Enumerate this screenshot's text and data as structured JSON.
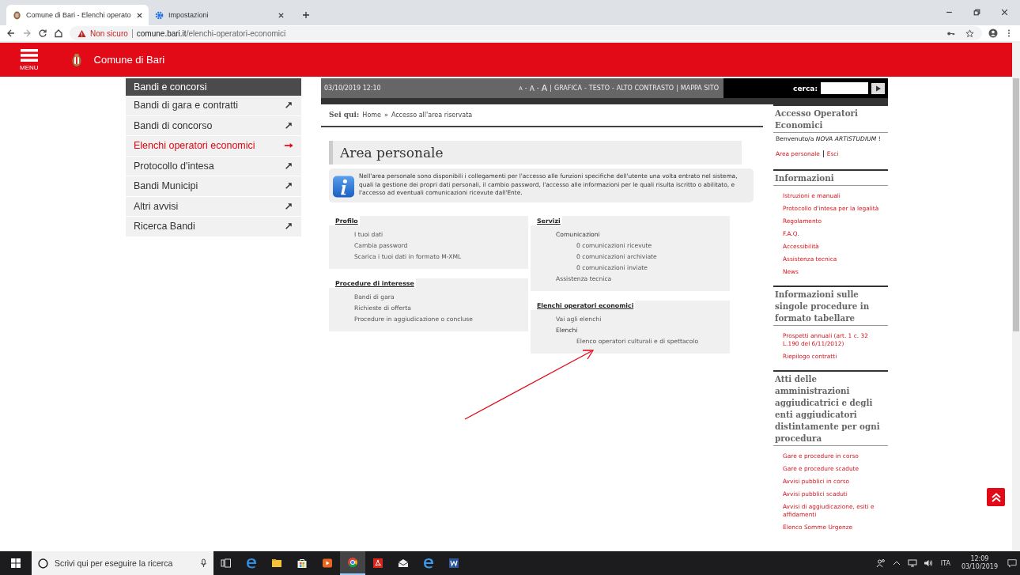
{
  "browser": {
    "tabs": [
      {
        "title": "Comune di Bari - Elenchi operato",
        "selected": true,
        "kind": "crest"
      },
      {
        "title": "Impostazioni",
        "selected": false,
        "kind": "gear"
      }
    ],
    "security": "Non sicuro",
    "url_host": "comune.bari.it",
    "url_path": "/elenchi-operatori-economici"
  },
  "header": {
    "menu_label": "MENU",
    "site_name": "Comune di Bari"
  },
  "left_menu": {
    "title": "Bandi e concorsi",
    "items": [
      {
        "label": "Bandi di gara e contratti",
        "selected": false
      },
      {
        "label": "Bandi di concorso",
        "selected": false
      },
      {
        "label": "Elenchi operatori economici",
        "selected": true
      },
      {
        "label": "Protocollo d'intesa",
        "selected": false
      },
      {
        "label": "Bandi Municipi",
        "selected": false
      },
      {
        "label": "Altri avvisi",
        "selected": false
      },
      {
        "label": "Ricerca Bandi",
        "selected": false
      }
    ]
  },
  "top_bar": {
    "datetime": "03/10/2019 12:10",
    "tools": [
      {
        "text": "A",
        "kind": "size-small"
      },
      {
        "text": "-",
        "kind": "sep"
      },
      {
        "text": "A",
        "kind": "size-medium"
      },
      {
        "text": "-",
        "kind": "sep"
      },
      {
        "text": "A",
        "kind": "size-large"
      },
      {
        "text": "|",
        "kind": "sep"
      },
      {
        "text": "GRAFICA",
        "kind": "link"
      },
      {
        "text": "-",
        "kind": "sep"
      },
      {
        "text": "TESTO",
        "kind": "link"
      },
      {
        "text": "-",
        "kind": "sep"
      },
      {
        "text": "ALTO CONTRASTO",
        "kind": "link"
      },
      {
        "text": "|",
        "kind": "sep"
      },
      {
        "text": "MAPPA SITO",
        "kind": "link"
      }
    ],
    "search_label": "cerca:"
  },
  "breadcrumb": {
    "label": "Sei qui:",
    "items": [
      "Home",
      "Accesso all'area riservata"
    ],
    "separator": "»"
  },
  "page_title": "Area personale",
  "intro": "Nell'area personale sono disponibili i collegamenti per l'accesso alle funzioni specifiche dell'utente una volta entrato nel sistema, quali la gestione dei propri dati personali, il cambio password, l'accesso alle informazioni per le quali risulta iscritto o abilitato, e l'accesso ad eventuali comunicazioni ricevute dall'Ente.",
  "sections": [
    [
      {
        "title": "Profilo",
        "items": [
          {
            "label": "I tuoi dati"
          },
          {
            "label": "Cambia password"
          },
          {
            "label": "Scarica i tuoi dati in formato M-XML"
          }
        ]
      },
      {
        "title": "Procedure di interesse",
        "items": [
          {
            "label": "Bandi di gara"
          },
          {
            "label": "Richieste di offerta"
          },
          {
            "label": "Procedure in aggiudicazione o concluse"
          }
        ]
      }
    ],
    [
      {
        "title": "Servizi",
        "items": [
          {
            "label": "Comunicazioni",
            "children": [
              {
                "label": "0 comunicazioni ricevute"
              },
              {
                "label": "0 comunicazioni archiviate"
              },
              {
                "label": "0 comunicazioni inviate"
              }
            ]
          },
          {
            "label": "Assistenza tecnica"
          }
        ]
      },
      {
        "title": "Elenchi operatori economici",
        "items": [
          {
            "label": "Vai agli elenchi"
          },
          {
            "label": "Elenchi",
            "children": [
              {
                "label": "Elenco operatori culturali e di spettacolo"
              }
            ]
          }
        ]
      }
    ]
  ],
  "sidebar": [
    {
      "kind": "welcome",
      "title": "Accesso Operatori Economici",
      "text": "Benvenuto/a *NOVA ARTISTUDIUM* !",
      "links": [
        "Area personale",
        "Esci"
      ]
    },
    {
      "kind": "links",
      "title": "Informazioni",
      "links": [
        "Istruzioni e manuali",
        "Protocollo d'intesa per la legalità",
        "Regolamento",
        "F.A.Q.",
        "Accessibilità",
        "Assistenza tecnica",
        "News"
      ]
    },
    {
      "kind": "links",
      "title": "Informazioni sulle singole procedure in formato tabellare",
      "links": [
        "Prospetti annuali (art. 1 c. 32 L.190 del 6/11/2012)",
        "Riepilogo contratti"
      ]
    },
    {
      "kind": "links",
      "title": "Atti delle amministrazioni aggiudicatrici e degli enti aggiudicatori distintamente per ogni procedura",
      "links": [
        "Gare e procedure in corso",
        "Gare e procedure scadute",
        "Avvisi pubblici in corso",
        "Avvisi pubblici scaduti",
        "Avvisi di aggiudicazione, esiti e affidamenti",
        "Elenco Somme Urgenze"
      ]
    }
  ],
  "taskbar": {
    "search_placeholder": "Scrivi qui per eseguire la ricerca",
    "language": "ITA",
    "time": "12:09",
    "date": "03/10/2019"
  }
}
